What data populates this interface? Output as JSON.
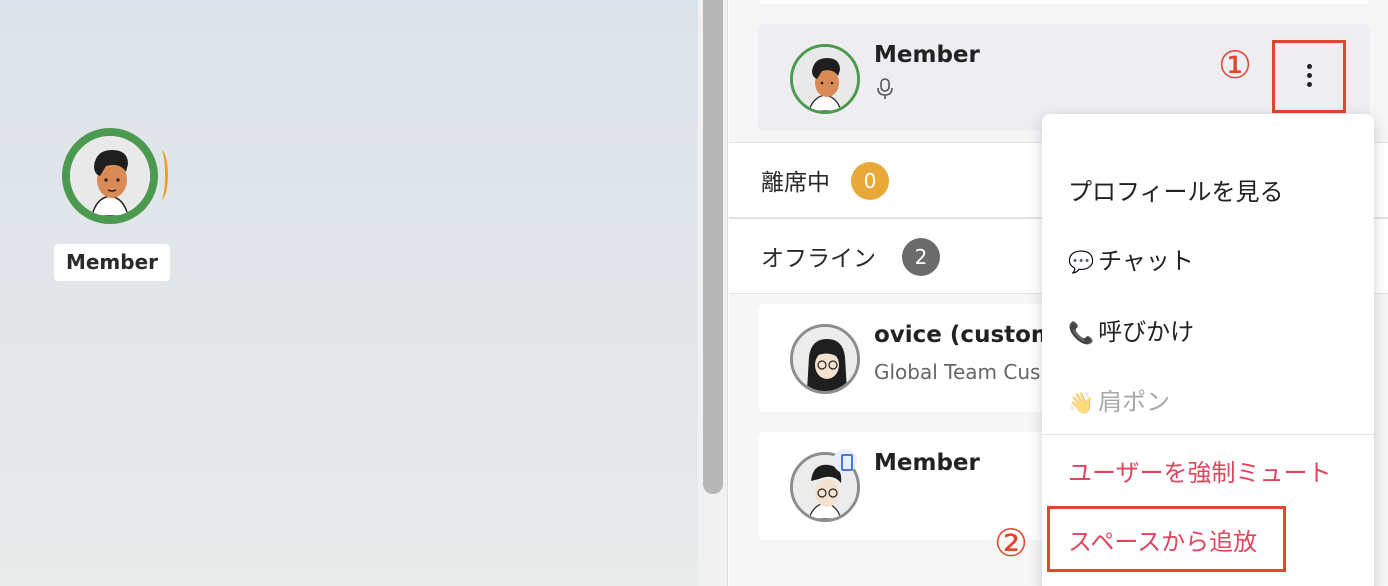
{
  "canvas": {
    "avatar_name": "Member"
  },
  "member_list": {
    "active_member": {
      "name": "Member",
      "status_icon": "microphone-icon",
      "ring_color": "#4c9a4f"
    },
    "away_section": {
      "label": "離席中",
      "count": "0",
      "badge_color": "#e8a83a"
    },
    "offline_section": {
      "label": "オフライン",
      "count": "2",
      "badge_color": "#6b6b6b"
    },
    "offline_members": [
      {
        "name": "ovice (custom",
        "subtitle": "Global Team Cus"
      },
      {
        "name": "Member",
        "device_icon": "mobile-device-icon"
      }
    ]
  },
  "annotations": {
    "step1": "①",
    "step2": "②",
    "highlight_color": "#e0472d"
  },
  "context_menu": {
    "items": [
      {
        "label": "プロフィールを見る",
        "icon": ""
      },
      {
        "label": "チャット",
        "icon": "💬"
      },
      {
        "label": "呼びかけ",
        "icon": "📞"
      },
      {
        "label": "肩ポン",
        "icon": "👋",
        "disabled": true
      },
      {
        "label": "ユーザーを強制ミュート",
        "icon": "",
        "danger": true
      },
      {
        "label": "スペースから追放",
        "icon": "",
        "danger": true
      }
    ]
  }
}
